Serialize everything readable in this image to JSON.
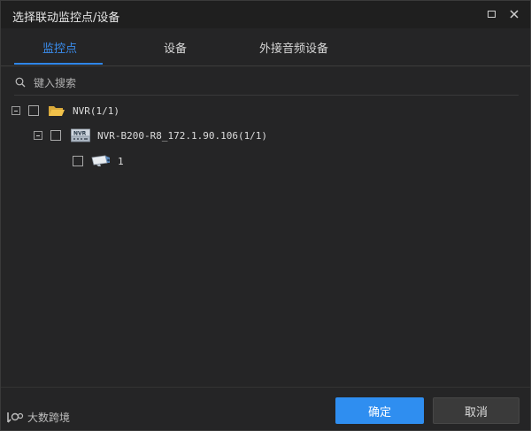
{
  "window": {
    "title": "选择联动监控点/设备"
  },
  "tabs": [
    {
      "label": "监控点",
      "active": true
    },
    {
      "label": "设备",
      "active": false
    },
    {
      "label": "外接音频设备",
      "active": false
    }
  ],
  "search": {
    "placeholder": "键入搜索"
  },
  "tree": {
    "root": {
      "label": "NVR(1/1)",
      "icon": "folder-open-icon"
    },
    "device": {
      "label": "NVR-B200-R8_172.1.90.106(1/1)",
      "icon": "nvr-device-icon",
      "badge": "NVR"
    },
    "channel": {
      "label": "1",
      "icon": "camera-icon"
    }
  },
  "footer": {
    "confirm_label": "确定",
    "cancel_label": "取消"
  },
  "watermark": {
    "text": "大数跨境"
  },
  "colors": {
    "accent": "#2f8ef0",
    "background": "#252526",
    "folder": "#f2c24a"
  }
}
